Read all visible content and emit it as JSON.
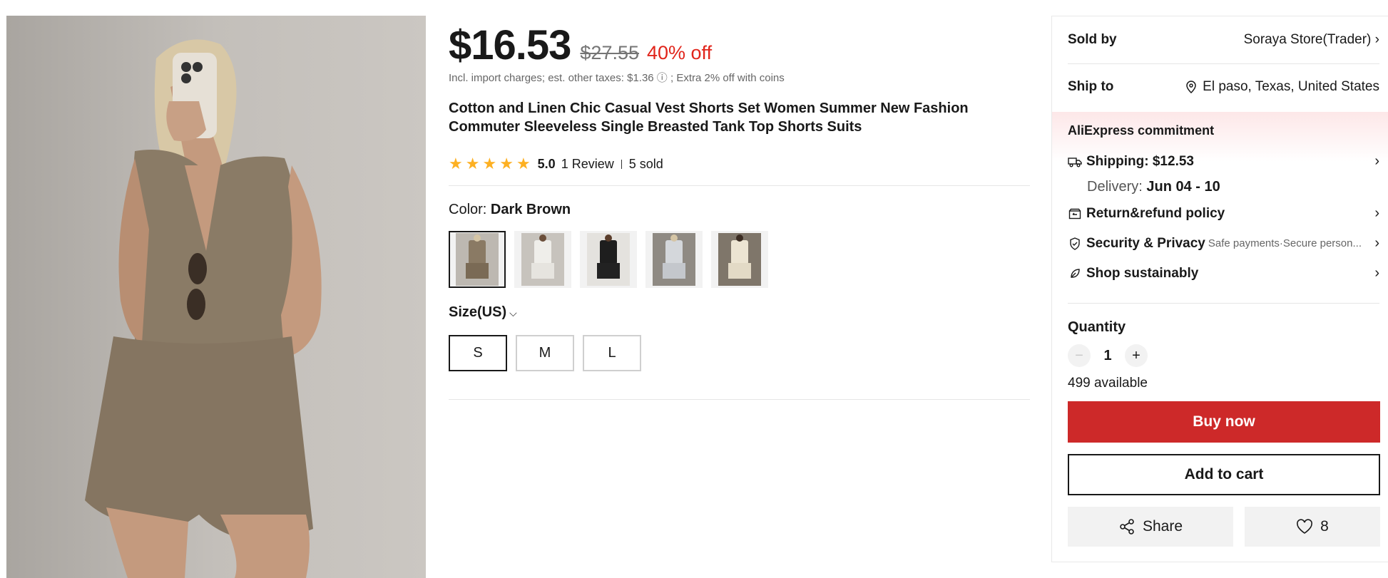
{
  "price": {
    "current": "$16.53",
    "original": "$27.55",
    "discount": "40% off",
    "tax_note": "Incl. import charges; est. other taxes: $1.36 ⓘ ; Extra 2% off with coins"
  },
  "product": {
    "title": "Cotton and Linen Chic Casual Vest Shorts Set Women Summer New Fashion Commuter Sleeveless Single Breasted Tank Top Shorts Suits",
    "rating": "5.0",
    "reviews": "1 Review",
    "sold": "5 sold",
    "star_count": 5
  },
  "color": {
    "label": "Color: ",
    "selected": "Dark Brown",
    "swatches": [
      {
        "name": "Dark Brown",
        "top": "#8a7a64",
        "bottom": "#7a6a55"
      },
      {
        "name": "White",
        "top": "#ededea",
        "bottom": "#e6e4df"
      },
      {
        "name": "Black",
        "top": "#1e1e1e",
        "bottom": "#222222"
      },
      {
        "name": "Light Gray",
        "top": "#cfd2d6",
        "bottom": "#c4c7cc"
      },
      {
        "name": "Cream",
        "top": "#e9e1cf",
        "bottom": "#e3dac6"
      }
    ]
  },
  "size": {
    "label": "Size(US)",
    "options": [
      "S",
      "M",
      "L"
    ],
    "selected": "S"
  },
  "panel": {
    "sold_by_label": "Sold by",
    "sold_by_value": "Soraya Store(Trader)",
    "ship_to_label": "Ship to",
    "ship_to_value": "El paso, Texas, United States",
    "commitment_title": "AliExpress commitment",
    "shipping": "Shipping: $12.53",
    "delivery_label": "Delivery: ",
    "delivery_value": "Jun 04 - 10",
    "return_policy": "Return&refund policy",
    "security": "Security & Privacy",
    "security_sub": "Safe payments·Secure person...",
    "sustainable": "Shop sustainably",
    "quantity_label": "Quantity",
    "quantity_value": "1",
    "available": "499 available",
    "buy_now": "Buy now",
    "add_to_cart": "Add to cart",
    "share": "Share",
    "wishlist_count": "8"
  },
  "colors": {
    "accent_red": "#e1251b",
    "buy_button": "#cd2929",
    "star": "#fdb022"
  }
}
